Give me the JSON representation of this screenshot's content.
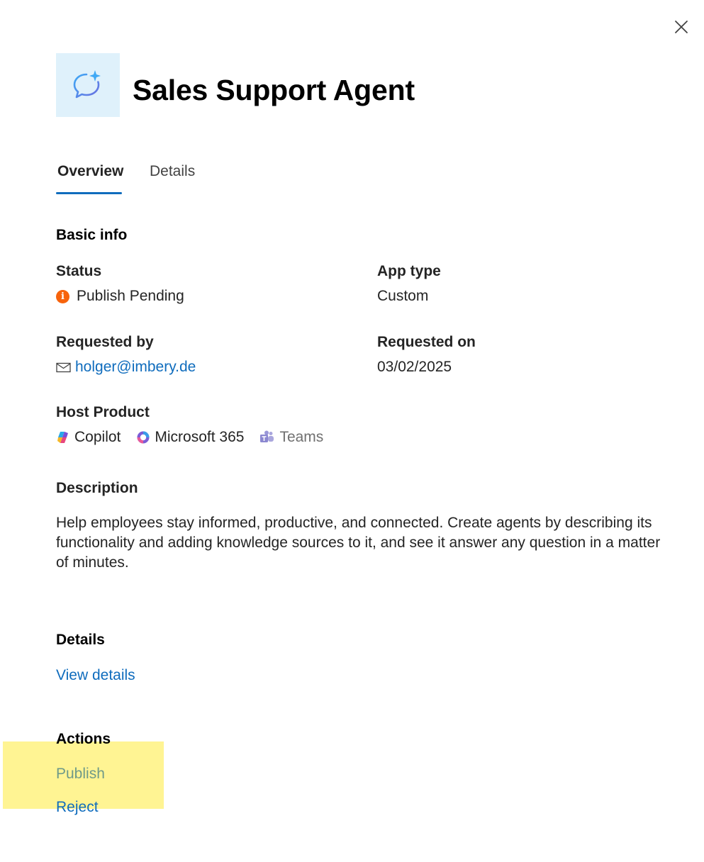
{
  "header": {
    "title": "Sales Support Agent"
  },
  "tabs": [
    {
      "label": "Overview",
      "selected": true
    },
    {
      "label": "Details",
      "selected": false
    }
  ],
  "basic_info": {
    "heading": "Basic info",
    "status_label": "Status",
    "status_value": "Publish Pending",
    "status_icon": "info-icon",
    "status_color": "#f7630c",
    "app_type_label": "App type",
    "app_type_value": "Custom",
    "requested_by_label": "Requested by",
    "requested_by_value": "holger@imbery.de",
    "requested_on_label": "Requested on",
    "requested_on_value": "03/02/2025",
    "host_product_label": "Host Product",
    "host_products": [
      "Copilot",
      "Microsoft 365",
      "Teams"
    ],
    "description_label": "Description",
    "description_text": "Help employees stay informed, productive, and connected. Create agents by describing its functionality and adding knowledge sources to it, and see it answer any question in a matter of minutes."
  },
  "details_section": {
    "heading": "Details",
    "link": "View details"
  },
  "actions_section": {
    "heading": "Actions",
    "publish": "Publish",
    "reject": "Reject"
  },
  "colors": {
    "accent": "#0f6cbd",
    "highlight": "#fff176"
  }
}
